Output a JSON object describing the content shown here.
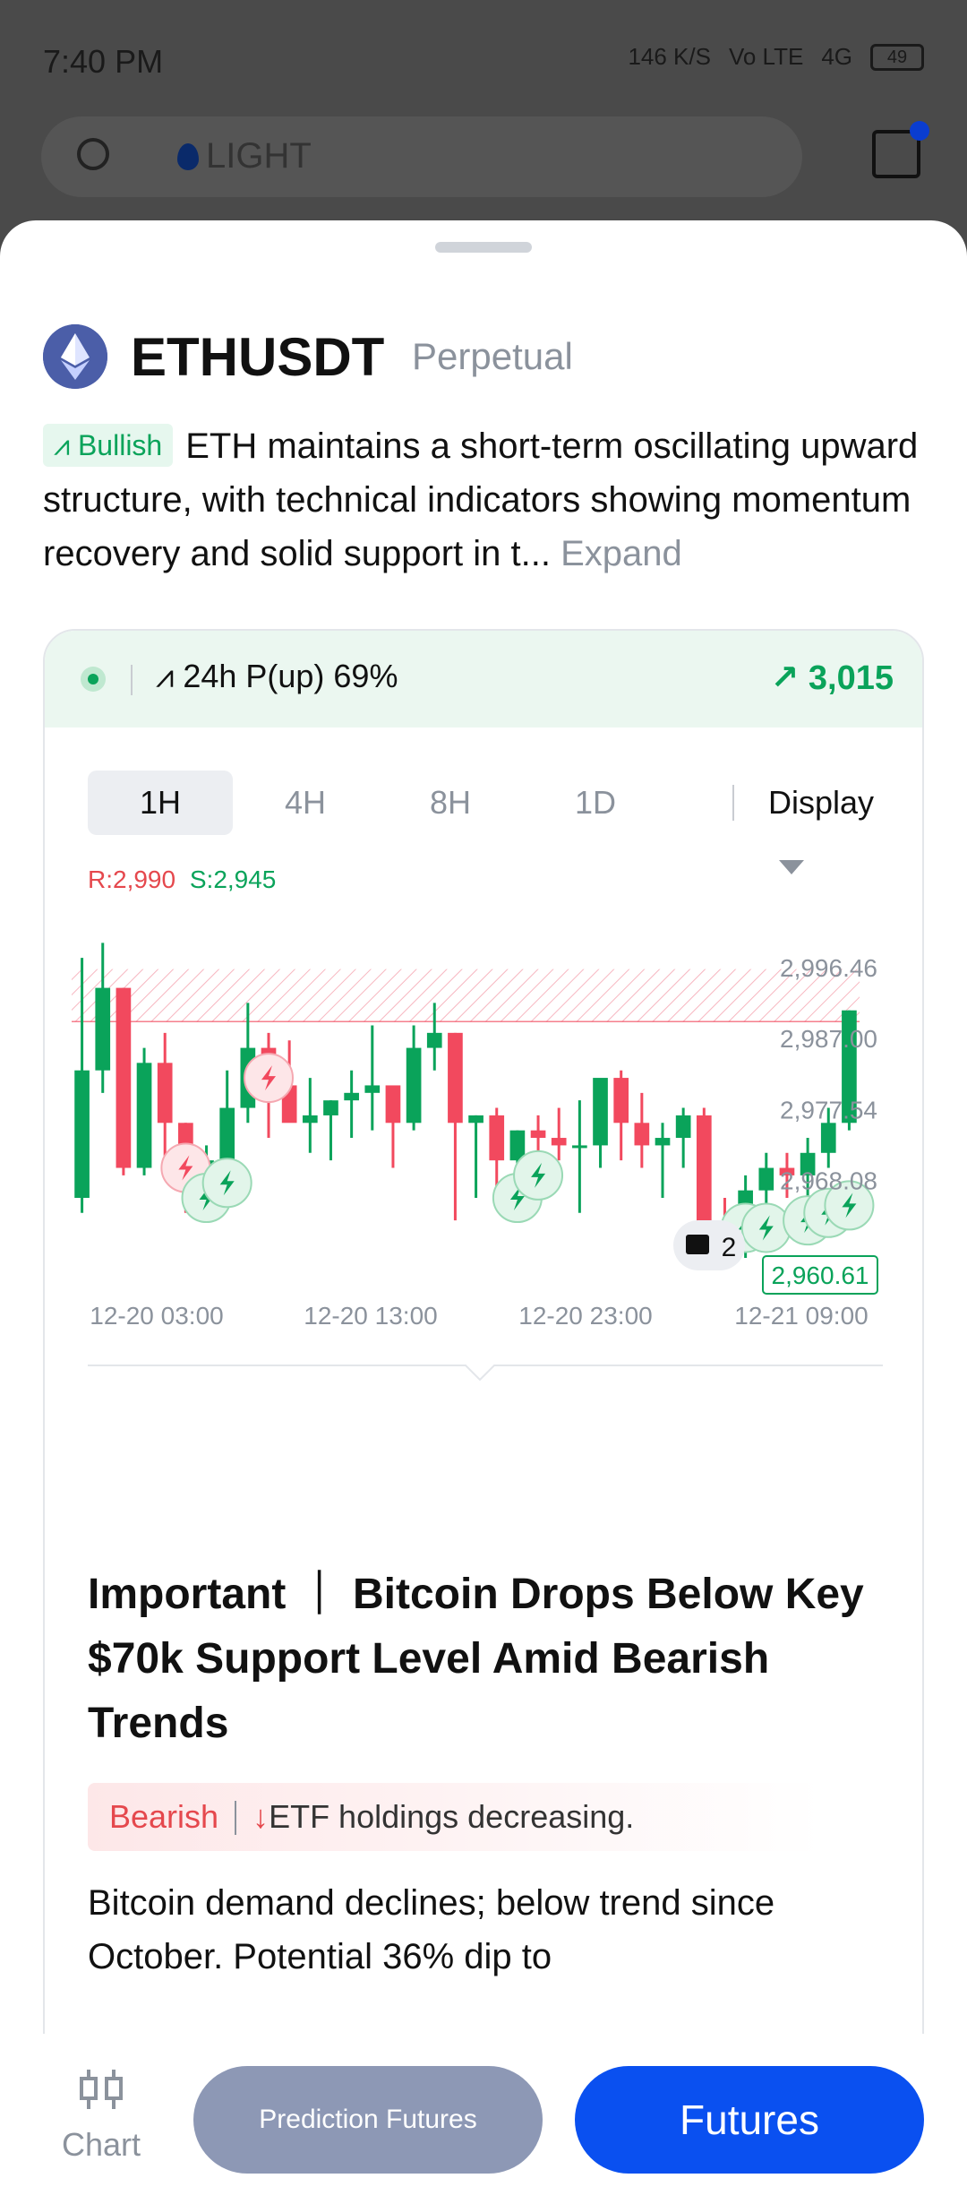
{
  "status_bar": {
    "time": "7:40 PM",
    "net_speed": "146 K/S",
    "volte": "Vo LTE",
    "network": "4G",
    "battery": "49"
  },
  "background_header": {
    "search_text": "LIGHT"
  },
  "instrument": {
    "symbol": "ETHUSDT",
    "type": "Perpetual",
    "sentiment_tag": "Bullish",
    "summary": "ETH maintains a short-term oscillating upward structure, with technical indicators showing momentum recovery and solid support in t...",
    "expand_label": "Expand"
  },
  "prediction": {
    "label": "24h P(up) 69%",
    "price": "3,015"
  },
  "timeframes": [
    {
      "label": "1H"
    },
    {
      "label": "4H"
    },
    {
      "label": "8H"
    },
    {
      "label": "1D"
    }
  ],
  "active_timeframe": "1H",
  "display_label": "Display",
  "levels": {
    "resistance": "R:2,990",
    "support": "S:2,945"
  },
  "colors": {
    "up": "#0aa35a",
    "down": "#f2495e",
    "accent": "#0a50f0",
    "resistance_zone": "#fbd7dc"
  },
  "chart_data": {
    "type": "candlestick",
    "y_ticks": [
      "2,996.46",
      "2,987.00",
      "2,977.54",
      "2,968.08"
    ],
    "ylim": [
      2958,
      3001
    ],
    "x_ticks": [
      "12-20 03:00",
      "12-20 13:00",
      "12-20 23:00",
      "12-21 09:00"
    ],
    "resistance_zone": [
      2989.5,
      2996.5
    ],
    "last_price": "2,960.61",
    "news_count": "2",
    "candles": [
      {
        "o": 2966,
        "h": 2998,
        "l": 2964,
        "c": 2983
      },
      {
        "o": 2983,
        "h": 3000,
        "l": 2980,
        "c": 2994
      },
      {
        "o": 2994,
        "h": 2994,
        "l": 2969,
        "c": 2970
      },
      {
        "o": 2970,
        "h": 2986,
        "l": 2969,
        "c": 2984
      },
      {
        "o": 2984,
        "h": 2988,
        "l": 2970,
        "c": 2976
      },
      {
        "o": 2976,
        "h": 2976,
        "l": 2964,
        "c": 2968
      },
      {
        "o": 2968,
        "h": 2973,
        "l": 2967,
        "c": 2971
      },
      {
        "o": 2971,
        "h": 2983,
        "l": 2966,
        "c": 2978
      },
      {
        "o": 2978,
        "h": 2992,
        "l": 2976,
        "c": 2986
      },
      {
        "o": 2986,
        "h": 2988,
        "l": 2974,
        "c": 2981
      },
      {
        "o": 2981,
        "h": 2987,
        "l": 2977,
        "c": 2976
      },
      {
        "o": 2976,
        "h": 2982,
        "l": 2972,
        "c": 2977
      },
      {
        "o": 2977,
        "h": 2979,
        "l": 2971,
        "c": 2979
      },
      {
        "o": 2979,
        "h": 2983,
        "l": 2974,
        "c": 2980
      },
      {
        "o": 2980,
        "h": 2989,
        "l": 2975,
        "c": 2981
      },
      {
        "o": 2981,
        "h": 2981,
        "l": 2970,
        "c": 2976
      },
      {
        "o": 2976,
        "h": 2989,
        "l": 2975,
        "c": 2986
      },
      {
        "o": 2986,
        "h": 2992,
        "l": 2983,
        "c": 2988
      },
      {
        "o": 2988,
        "h": 2988,
        "l": 2963,
        "c": 2976
      },
      {
        "o": 2976,
        "h": 2977,
        "l": 2966,
        "c": 2977
      },
      {
        "o": 2977,
        "h": 2978,
        "l": 2965,
        "c": 2971
      },
      {
        "o": 2971,
        "h": 2975,
        "l": 2968,
        "c": 2975
      },
      {
        "o": 2975,
        "h": 2977,
        "l": 2967,
        "c": 2974
      },
      {
        "o": 2974,
        "h": 2978,
        "l": 2971,
        "c": 2973
      },
      {
        "o": 2973,
        "h": 2979,
        "l": 2964,
        "c": 2973
      },
      {
        "o": 2973,
        "h": 2980,
        "l": 2970,
        "c": 2982
      },
      {
        "o": 2982,
        "h": 2983,
        "l": 2971,
        "c": 2976
      },
      {
        "o": 2976,
        "h": 2980,
        "l": 2970,
        "c": 2973
      },
      {
        "o": 2973,
        "h": 2976,
        "l": 2966,
        "c": 2974
      },
      {
        "o": 2974,
        "h": 2978,
        "l": 2970,
        "c": 2977
      },
      {
        "o": 2977,
        "h": 2978,
        "l": 2959,
        "c": 2962
      },
      {
        "o": 2962,
        "h": 2966,
        "l": 2958,
        "c": 2960
      },
      {
        "o": 2960,
        "h": 2969,
        "l": 2958,
        "c": 2967
      },
      {
        "o": 2967,
        "h": 2972,
        "l": 2963,
        "c": 2970
      },
      {
        "o": 2970,
        "h": 2972,
        "l": 2966,
        "c": 2969
      },
      {
        "o": 2969,
        "h": 2974,
        "l": 2965,
        "c": 2972
      },
      {
        "o": 2972,
        "h": 2978,
        "l": 2970,
        "c": 2976
      },
      {
        "o": 2976,
        "h": 2991,
        "l": 2975,
        "c": 2991
      }
    ],
    "signals": [
      {
        "i": 5,
        "v": 2970,
        "kind": "down"
      },
      {
        "i": 6,
        "v": 2966,
        "kind": "up"
      },
      {
        "i": 7,
        "v": 2968,
        "kind": "up"
      },
      {
        "i": 9,
        "v": 2982,
        "kind": "down"
      },
      {
        "i": 21,
        "v": 2966,
        "kind": "up"
      },
      {
        "i": 22,
        "v": 2969,
        "kind": "up"
      },
      {
        "i": 32,
        "v": 2962,
        "kind": "up"
      },
      {
        "i": 33,
        "v": 2962,
        "kind": "up"
      },
      {
        "i": 35,
        "v": 2963,
        "kind": "up"
      },
      {
        "i": 36,
        "v": 2964,
        "kind": "up"
      },
      {
        "i": 37,
        "v": 2965,
        "kind": "up"
      }
    ]
  },
  "article": {
    "title": "Important ｜ Bitcoin Drops Below Key $70k Support Level Amid Bearish Trends",
    "sentiment": "Bearish",
    "reason": "ETF holdings decreasing.",
    "body": "Bitcoin demand declines; below trend since October. Potential 36% dip to"
  },
  "bottom_bar": {
    "chart_label": "Chart",
    "prediction_label": "Prediction Futures",
    "futures_label": "Futures"
  }
}
